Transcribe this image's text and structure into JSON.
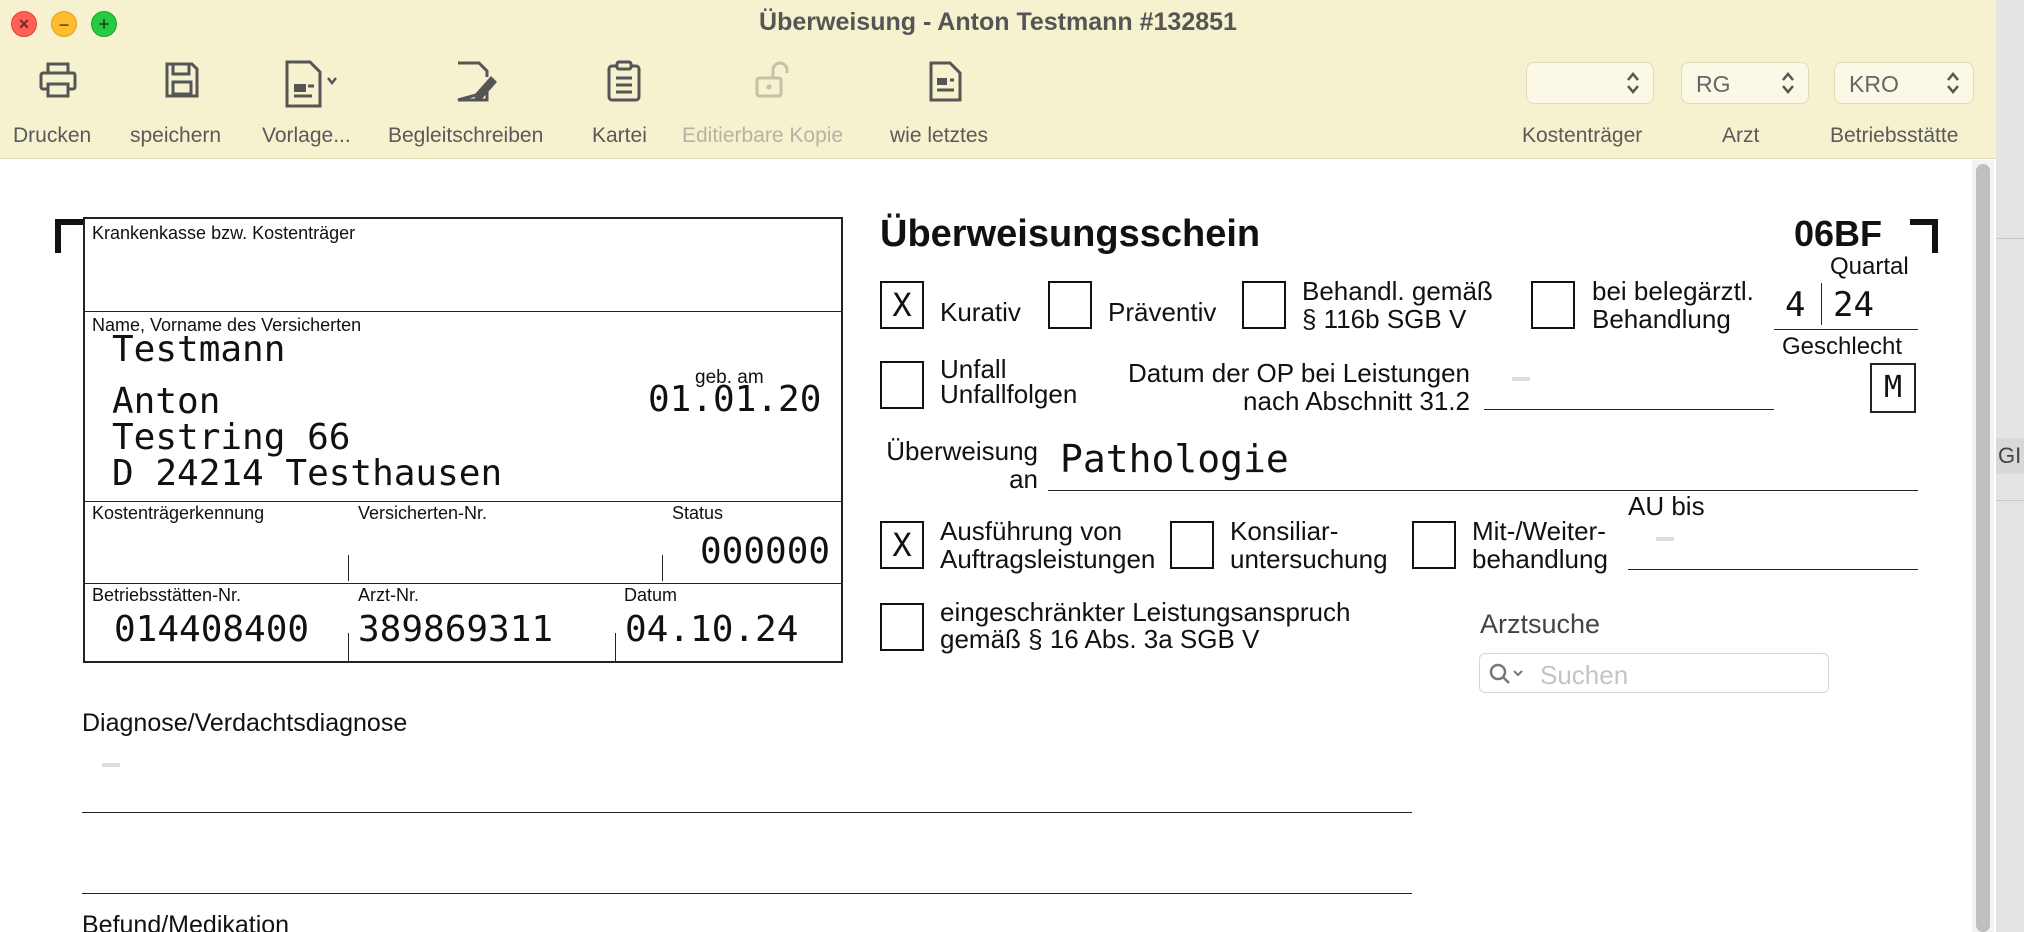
{
  "window": {
    "title": "Überweisung -  Anton Testmann #132851"
  },
  "toolbar": {
    "items": [
      {
        "label": "Drucken",
        "icon": "printer-icon",
        "enabled": true
      },
      {
        "label": "speichern",
        "icon": "save-disk-icon",
        "enabled": true
      },
      {
        "label": "Vorlage...",
        "icon": "template-document-icon",
        "enabled": true
      },
      {
        "label": "Begleitschreiben",
        "icon": "document-pen-icon",
        "enabled": true
      },
      {
        "label": "Kartei",
        "icon": "clipboard-icon",
        "enabled": true
      },
      {
        "label": "Editierbare Kopie",
        "icon": "unlock-icon",
        "enabled": false
      },
      {
        "label": "wie letztes",
        "icon": "document-copy-icon",
        "enabled": true
      }
    ],
    "popups": [
      {
        "label": "Kostenträger",
        "value": ""
      },
      {
        "label": "Arzt",
        "value": "RG"
      },
      {
        "label": "Betriebsstätte",
        "value": "KRO"
      }
    ]
  },
  "form": {
    "kasse_label": "Krankenkasse bzw. Kostenträger",
    "name_label": "Name, Vorname des Versicherten",
    "surname": "Testmann",
    "firstname": "Anton",
    "street": "Testring 66",
    "city": "D 24214 Testhausen",
    "dob_label": "geb. am",
    "dob": "01.01.20",
    "ktk_label": "Kostenträgerkennung",
    "vnr_label": "Versicherten-Nr.",
    "status_label": "Status",
    "status": "000000",
    "bsnr_label": "Betriebsstätten-Nr.",
    "bsnr": "014408400",
    "arztnr_label": "Arzt-Nr.",
    "arztnr": "389869311",
    "datum_label": "Datum",
    "datum": "04.10.24",
    "title": "Überweisungsschein",
    "form_code": "06BF",
    "quartal_label": "Quartal",
    "quartal_q": "4",
    "quartal_y": "24",
    "geschlecht_label": "Geschlecht",
    "geschlecht": "M",
    "check_mark": "X",
    "kurativ": {
      "label": "Kurativ",
      "checked": true
    },
    "praeventiv": {
      "label": "Präventiv",
      "checked": false
    },
    "behandl_116b": {
      "line1": "Behandl. gemäß",
      "line2": "§ 116b SGB V",
      "checked": false
    },
    "belegarzt": {
      "line1": "bei belegärztl.",
      "line2": "Behandlung",
      "checked": false
    },
    "unfall": {
      "line1": "Unfall",
      "line2": "Unfallfolgen",
      "checked": false
    },
    "op_datum": {
      "line1": "Datum der OP bei Leistungen",
      "line2": "nach Abschnitt 31.2"
    },
    "ueberweisung_an_line1": "Überweisung",
    "ueberweisung_an_line2": "an",
    "ueberweisung_an": "Pathologie",
    "ausfuehrung": {
      "line1": "Ausführung von",
      "line2": "Auftragsleistungen",
      "checked": true
    },
    "konsiliar": {
      "line1": "Konsiliar-",
      "line2": "untersuchung",
      "checked": false
    },
    "mitweiter": {
      "line1": "Mit-/Weiter-",
      "line2": "behandlung",
      "checked": false
    },
    "au_bis_label": "AU bis",
    "eingeschraenkt": {
      "line1": "eingeschränkter Leistungsanspruch",
      "line2": "gemäß § 16 Abs. 3a SGB V",
      "checked": false
    },
    "arztsuche_label": "Arztsuche",
    "search_placeholder": "Suchen",
    "diagnose_label": "Diagnose/Verdachtsdiagnose",
    "befund_label": "Befund/Medikation"
  },
  "right_edge_text": "GI"
}
